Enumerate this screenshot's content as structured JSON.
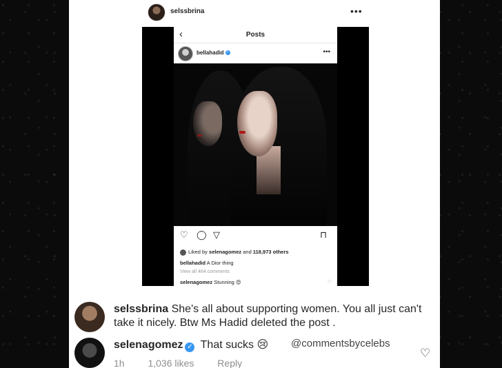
{
  "outer_post": {
    "username": "selssbrina",
    "more_icon": "•••"
  },
  "embedded": {
    "nav_title": "Posts",
    "back_icon": "‹",
    "post_username": "bellahadid",
    "more_icon": "•••",
    "liked_by_prefix": "Liked by",
    "liked_by_user": "selenagomez",
    "liked_by_and": "and",
    "liked_by_count": "118,973 others",
    "caption_user": "bellahadid",
    "caption_text": "A Dior thing",
    "view_all": "View all 464 comments",
    "comment_user": "selenagomez",
    "comment_text": "Stunning 😍"
  },
  "comments": [
    {
      "username": "selssbrina",
      "text": "She's all about supporting women. You all just can't take it nicely. Btw Ms Hadid deleted the post ."
    },
    {
      "username": "selenagomez",
      "text": "That sucks 😢",
      "watermark": "@commentsbycelebs",
      "time": "1h",
      "likes": "1,036 likes",
      "reply": "Reply"
    }
  ],
  "colors": {
    "verified": "#3897f0",
    "text": "#262626",
    "muted": "#8e8e8e"
  }
}
